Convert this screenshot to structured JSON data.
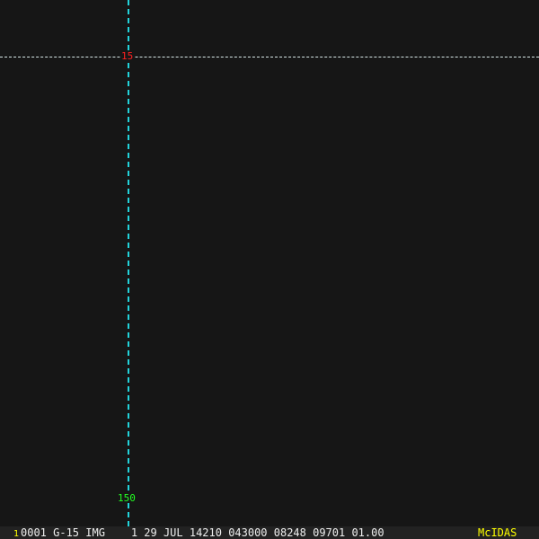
{
  "overlay": {
    "latitude_label": "15",
    "longitude_label": "150"
  },
  "status_bar": {
    "frame": "1",
    "text": "0001 G-15 IMG    1 29 JUL 14210 043000 08248 09701 01.00",
    "brand": "McIDAS"
  },
  "colors": {
    "lat_line": "#d8e8e8",
    "lon_line": "#22d4dc",
    "lat_label": "#ff2020",
    "lon_label": "#22ff22",
    "brand": "#ffff00"
  }
}
